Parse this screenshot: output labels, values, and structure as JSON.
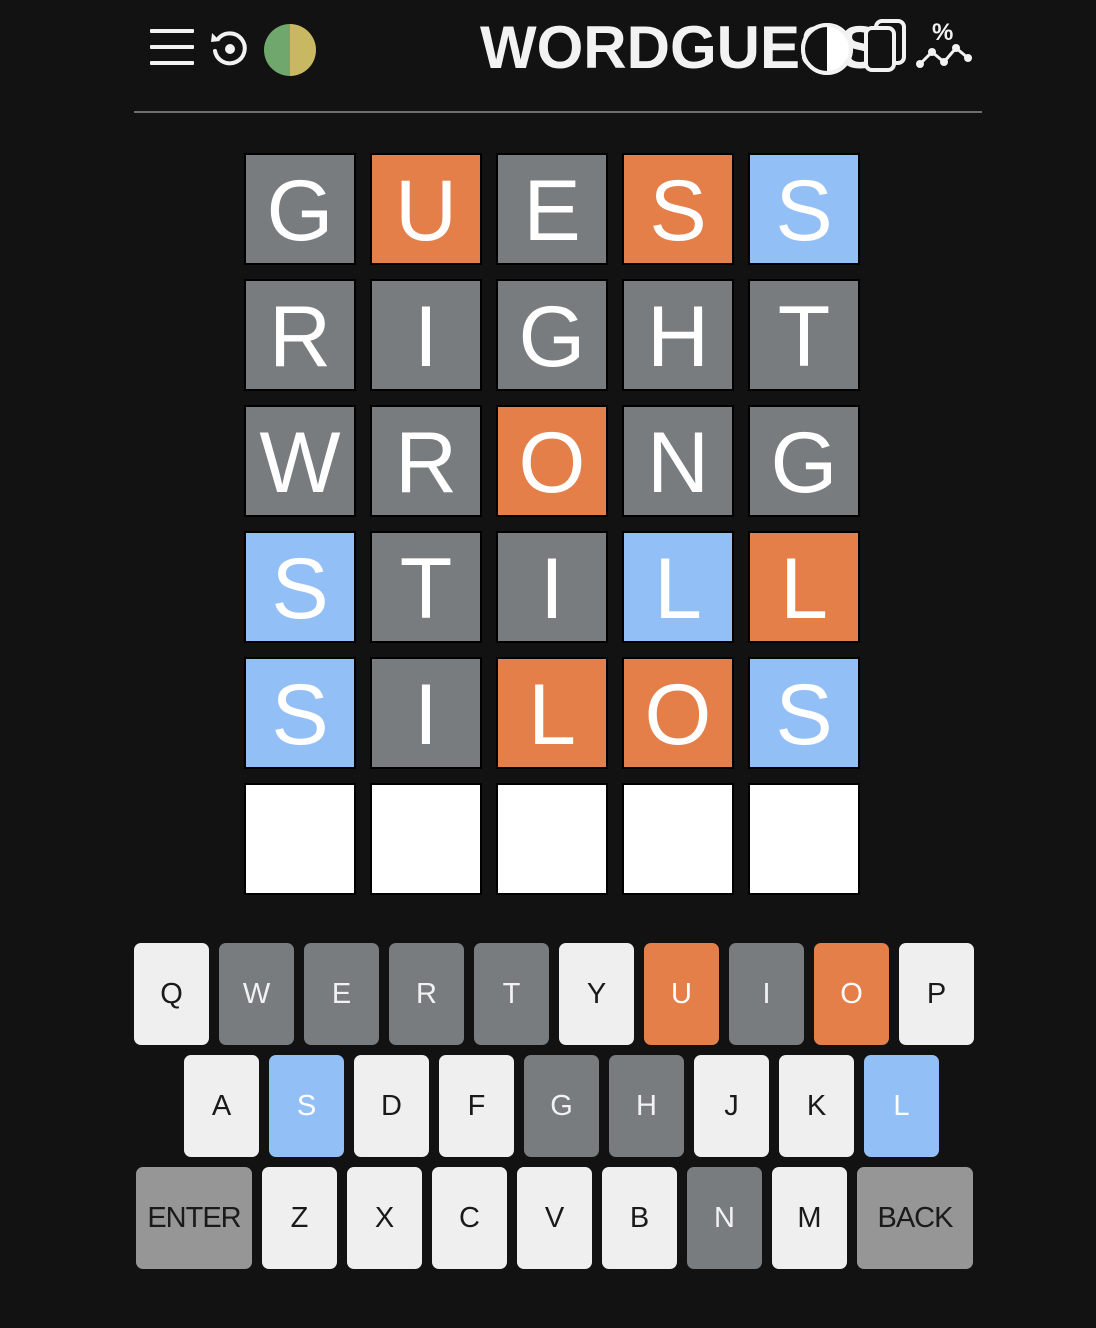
{
  "header": {
    "title": "WORDGUESS",
    "icons": [
      "menu-icon",
      "restart-icon",
      "color-mode-icon",
      "contrast-icon",
      "cards-icon",
      "stats-icon"
    ],
    "stats_icon_glyph": "%"
  },
  "colors": {
    "background": "#121212",
    "absent": "#787c7e",
    "orange": "#e57f4a",
    "blue": "#92bff5",
    "empty": "#ffffff",
    "key_default": "#efefef",
    "key_special": "#969696"
  },
  "board": {
    "rows": [
      {
        "letters": [
          "G",
          "U",
          "E",
          "S",
          "S"
        ],
        "states": [
          "absent",
          "orange",
          "absent",
          "orange",
          "blue"
        ]
      },
      {
        "letters": [
          "R",
          "I",
          "G",
          "H",
          "T"
        ],
        "states": [
          "absent",
          "absent",
          "absent",
          "absent",
          "absent"
        ]
      },
      {
        "letters": [
          "W",
          "R",
          "O",
          "N",
          "G"
        ],
        "states": [
          "absent",
          "absent",
          "orange",
          "absent",
          "absent"
        ]
      },
      {
        "letters": [
          "S",
          "T",
          "I",
          "L",
          "L"
        ],
        "states": [
          "blue",
          "absent",
          "absent",
          "blue",
          "orange"
        ]
      },
      {
        "letters": [
          "S",
          "I",
          "L",
          "O",
          "S"
        ],
        "states": [
          "blue",
          "absent",
          "orange",
          "orange",
          "blue"
        ]
      },
      {
        "letters": [
          "",
          "",
          "",
          "",
          ""
        ],
        "states": [
          "empty",
          "empty",
          "empty",
          "empty",
          "empty"
        ]
      }
    ]
  },
  "keyboard": {
    "rows": [
      [
        {
          "label": "Q",
          "state": "default"
        },
        {
          "label": "W",
          "state": "absent"
        },
        {
          "label": "E",
          "state": "absent"
        },
        {
          "label": "R",
          "state": "absent"
        },
        {
          "label": "T",
          "state": "absent"
        },
        {
          "label": "Y",
          "state": "default"
        },
        {
          "label": "U",
          "state": "orange"
        },
        {
          "label": "I",
          "state": "absent"
        },
        {
          "label": "O",
          "state": "orange"
        },
        {
          "label": "P",
          "state": "default"
        }
      ],
      [
        {
          "label": "A",
          "state": "default"
        },
        {
          "label": "S",
          "state": "blue"
        },
        {
          "label": "D",
          "state": "default"
        },
        {
          "label": "F",
          "state": "default"
        },
        {
          "label": "G",
          "state": "absent"
        },
        {
          "label": "H",
          "state": "absent"
        },
        {
          "label": "J",
          "state": "default"
        },
        {
          "label": "K",
          "state": "default"
        },
        {
          "label": "L",
          "state": "blue"
        }
      ],
      [
        {
          "label": "ENTER",
          "state": "special"
        },
        {
          "label": "Z",
          "state": "default"
        },
        {
          "label": "X",
          "state": "default"
        },
        {
          "label": "C",
          "state": "default"
        },
        {
          "label": "V",
          "state": "default"
        },
        {
          "label": "B",
          "state": "default"
        },
        {
          "label": "N",
          "state": "absent"
        },
        {
          "label": "M",
          "state": "default"
        },
        {
          "label": "BACK",
          "state": "special"
        }
      ]
    ]
  }
}
